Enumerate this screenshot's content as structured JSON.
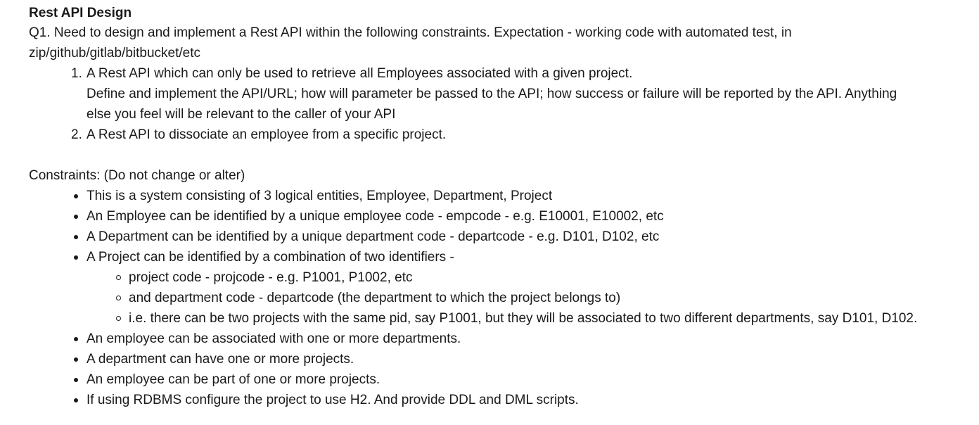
{
  "document": {
    "title": "Rest API Design",
    "q1_line1": "Q1. Need to design and implement a Rest API within the following constraints. Expectation - working code with automated test, in",
    "q1_line2": "zip/github/gitlab/bitbucket/etc",
    "tasks": [
      {
        "number": "1.",
        "line1": "A Rest API which can only be used to retrieve all Employees associated with a given project.",
        "line2": "Define and implement the API/URL; how will parameter be passed to the API; how success or failure will be reported by the API. Anything",
        "line3": "else you feel will be relevant to the caller of your API"
      },
      {
        "number": "2.",
        "line1": "A Rest API to dissociate an employee from a specific project."
      }
    ],
    "constraints_heading": "Constraints: (Do not change or alter)",
    "constraints": [
      "This is a system consisting of 3 logical entities, Employee, Department, Project",
      "An Employee can be identified by a unique employee code - empcode - e.g. E10001, E10002, etc",
      "A Department can be identified by a unique department code - departcode - e.g. D101, D102, etc",
      "A Project can be identified by a combination of two identifiers -",
      "An employee can be associated with one or more departments.",
      "A department can have one or more projects.",
      "An employee can be part of one or more projects.",
      "If using RDBMS configure the project to use H2. And provide DDL and DML scripts."
    ],
    "project_identifiers": [
      "project code - projcode - e.g. P1001, P1002, etc",
      "and department code - departcode (the department to which the project belongs to)",
      "i.e. there can be two projects with the same pid, say P1001, but they will be associated to two different departments, say D101, D102."
    ]
  }
}
